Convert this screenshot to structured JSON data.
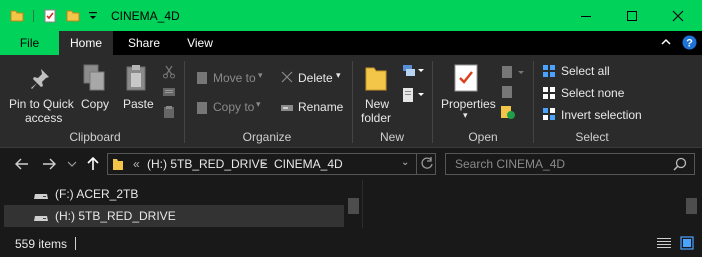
{
  "window": {
    "title": "CINEMA_4D",
    "accent_color": "#00d25a"
  },
  "quick_access": {
    "icons": [
      "folder-icon",
      "properties-icon",
      "new-folder-icon",
      "customize-dropdown-icon"
    ]
  },
  "window_controls": {
    "minimize": "minimize-icon",
    "maximize": "maximize-icon",
    "close": "close-icon"
  },
  "tabs": {
    "file": "File",
    "home": "Home",
    "share": "Share",
    "view": "View",
    "active": "Home"
  },
  "ribbon": {
    "clipboard": {
      "label": "Clipboard",
      "pin_line1": "Pin to Quick",
      "pin_line2": "access",
      "copy": "Copy",
      "paste": "Paste"
    },
    "organize": {
      "label": "Organize",
      "move_to": "Move to",
      "copy_to": "Copy to",
      "delete": "Delete",
      "rename": "Rename"
    },
    "new": {
      "label": "New",
      "new_folder_line1": "New",
      "new_folder_line2": "folder"
    },
    "open": {
      "label": "Open",
      "properties": "Properties"
    },
    "select": {
      "label": "Select",
      "select_all": "Select all",
      "select_none": "Select none",
      "invert_selection": "Invert selection"
    }
  },
  "address": {
    "overflow": "«",
    "crumb_drive": "(H:) 5TB_RED_DRIVE",
    "separator": ">",
    "crumb_folder": "CINEMA_4D",
    "search_placeholder": "Search CINEMA_4D"
  },
  "nav_pane": {
    "items": [
      {
        "label": "(F:) ACER_2TB",
        "icon": "drive-icon",
        "selected": false
      },
      {
        "label": "(H:) 5TB_RED_DRIVE",
        "icon": "drive-icon",
        "selected": true
      }
    ]
  },
  "status": {
    "item_count": "559 items"
  }
}
